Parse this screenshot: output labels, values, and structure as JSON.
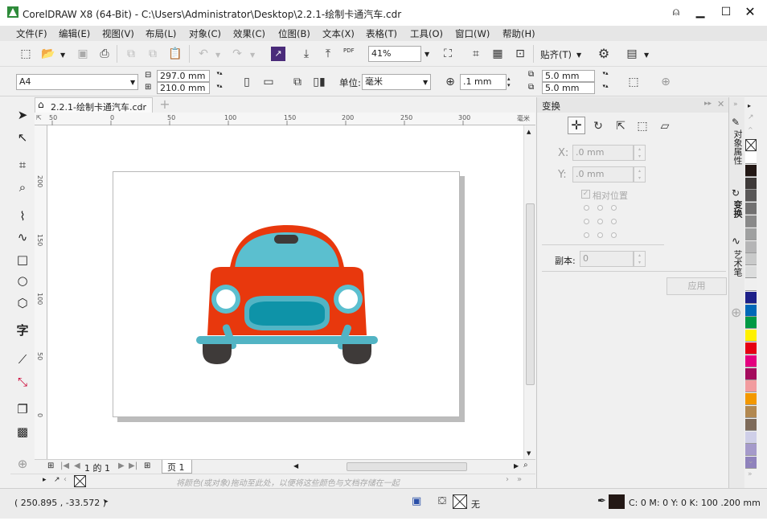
{
  "app": {
    "title": "CorelDRAW X8 (64-Bit) - C:\\Users\\Administrator\\Desktop\\2.2.1-绘制卡通汽车.cdr"
  },
  "menu": [
    "文件(F)",
    "编辑(E)",
    "视图(V)",
    "布局(L)",
    "对象(C)",
    "效果(C)",
    "位图(B)",
    "文本(X)",
    "表格(T)",
    "工具(O)",
    "窗口(W)",
    "帮助(H)"
  ],
  "toolbar": {
    "zoom": "41%",
    "snap_label": "贴齐(T)",
    "pdf_label": "PDF"
  },
  "propbar": {
    "page_size": "A4",
    "width": "297.0 mm",
    "height": "210.0 mm",
    "units_label": "单位:",
    "units": "毫米",
    "nudge": ".1 mm",
    "dup_x": "5.0 mm",
    "dup_y": "5.0 mm"
  },
  "document": {
    "tab_label": "2.2.1-绘制卡通汽车.cdr"
  },
  "ruler": {
    "unit": "毫米",
    "h_ticks": [
      "50",
      "0",
      "50",
      "100",
      "150",
      "200",
      "250",
      "300"
    ],
    "v_ticks": [
      "200",
      "150",
      "100",
      "50",
      "0"
    ]
  },
  "pager": {
    "page_of": "1 的 1",
    "page_tab": "页 1"
  },
  "palette_hint": "将颜色(或对象)拖动至此处，以便将这些颜色与文档存储在一起",
  "docker": {
    "title": "变换",
    "x_label": "X:",
    "x_value": ".0 mm",
    "y_label": "Y:",
    "y_value": ".0 mm",
    "relative_label": "相对位置",
    "copies_label": "副本:",
    "copies_value": "0",
    "apply_label": "应用"
  },
  "side_tabs": [
    "对象属性",
    "变换",
    "艺术笔"
  ],
  "palette_colors": [
    "#ffffff",
    "#231815",
    "#3e3a39",
    "#595757",
    "#727171",
    "#898989",
    "#9fa0a0",
    "#b5b5b6",
    "#c9caca",
    "#dcdddd",
    "#efefef",
    "#1d2088",
    "#0068b7",
    "#009944",
    "#fff100",
    "#e60012",
    "#e4007f",
    "#a40b5d",
    "#f29c9f",
    "#f39800",
    "#b28850",
    "#7e6b5a",
    "#cfcfe8",
    "#a59aca",
    "#8f82bc"
  ],
  "status": {
    "coords": "( 250.895 , -33.572 )",
    "fill_label": "无",
    "outline_info": "C: 0 M: 0 Y: 0 K: 100  .200 mm"
  },
  "colors": {
    "car_body": "#e8380d",
    "car_window": "#5bbfcf",
    "car_dark": "#3e3a39",
    "car_grille": "#0e93a8",
    "bumper": "#52b4c4",
    "outline_swatch": "#231815"
  }
}
